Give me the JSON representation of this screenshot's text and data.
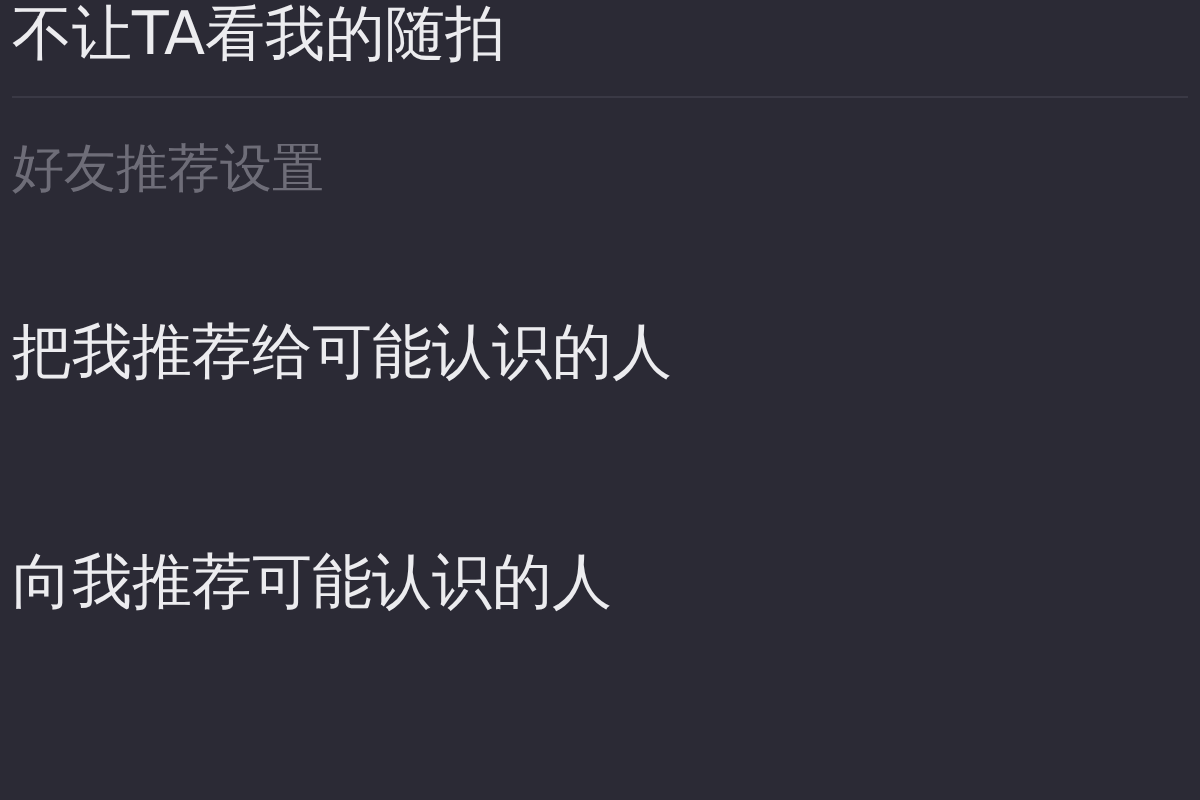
{
  "items": [
    {
      "kind": "setting",
      "label": "不让TA看我的随拍"
    },
    {
      "kind": "header",
      "label": "好友推荐设置"
    },
    {
      "kind": "setting",
      "label": "把我推荐给可能认识的人"
    },
    {
      "kind": "setting",
      "label": "向我推荐可能认识的人"
    }
  ]
}
